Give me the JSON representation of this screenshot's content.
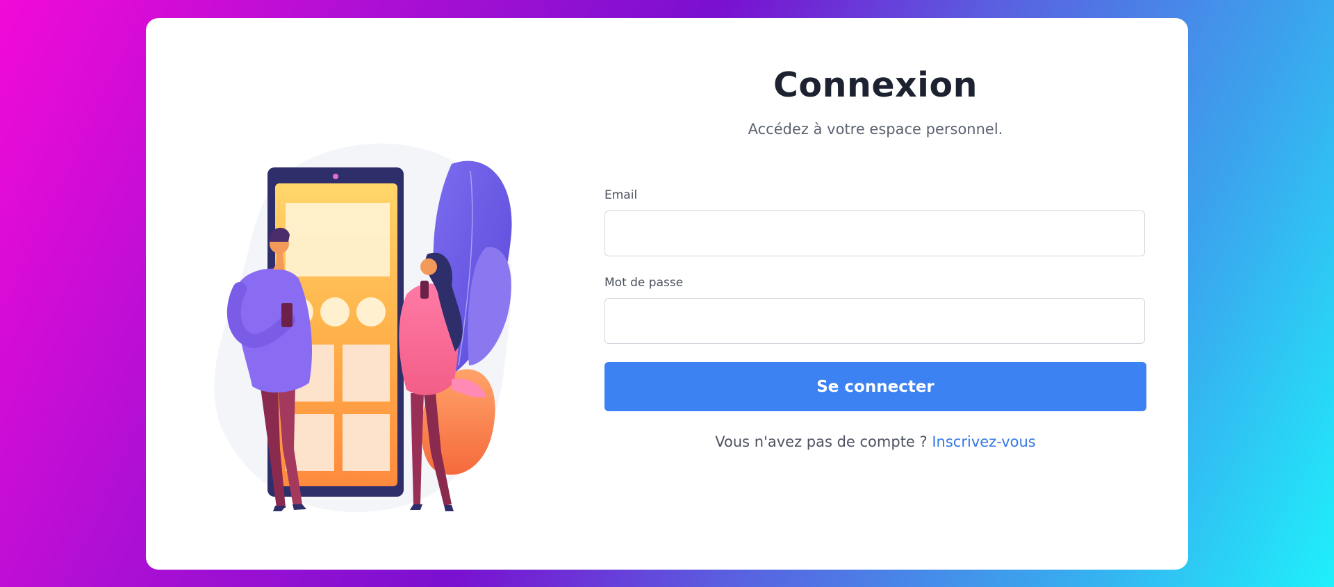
{
  "login": {
    "title": "Connexion",
    "subtitle": "Accédez à votre espace personnel.",
    "email_label": "Email",
    "email_value": "",
    "password_label": "Mot de passe",
    "password_value": "",
    "submit_label": "Se connecter",
    "signup_prompt": "Vous n'avez pas de compte ?",
    "signup_link": "Inscrivez-vous"
  },
  "colors": {
    "primary": "#3c82f2",
    "link": "#3477e6",
    "title": "#1c2230",
    "background_gradient": [
      "#f20ad8",
      "#7a10d0",
      "#1ff0fb"
    ]
  },
  "illustration": {
    "icon": "people-with-phone-illustration"
  }
}
